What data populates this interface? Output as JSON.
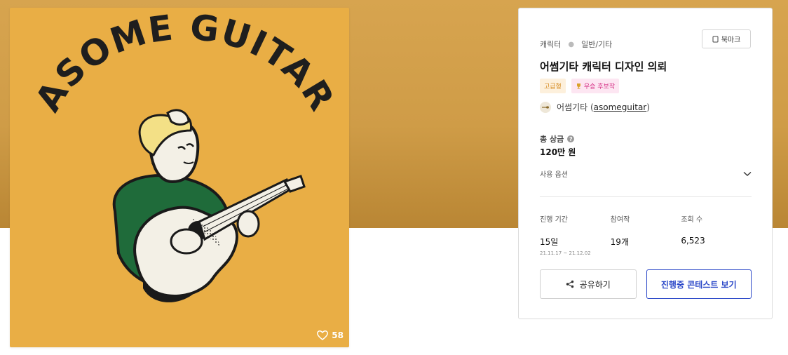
{
  "artwork": {
    "logo_text": "ASOME GUITAR",
    "likes": "58",
    "background_color": "#e9ae45",
    "hero_color": "#d7a44f"
  },
  "card": {
    "category": "캐릭터",
    "subcategory": "일반/기타",
    "bookmark_label": "북마크",
    "title": "어썸기타 캐릭터 디자인 의뢰",
    "badges": [
      {
        "label": "고급형",
        "icon": "none"
      },
      {
        "label": "우승 후보작",
        "icon": "trophy-icon"
      }
    ],
    "owner": {
      "name": "어썸기타",
      "handle": "asomeguitar"
    },
    "prize": {
      "label": "총 상금",
      "value": "120만 원"
    },
    "usage_label": "사용 옵션",
    "stats": [
      {
        "label": "진행 기간",
        "value": "15일",
        "sub": "21.11.17 ~ 21.12.02"
      },
      {
        "label": "참여작",
        "value": "19개"
      },
      {
        "label": "조회 수",
        "value": "6,523"
      }
    ],
    "share_label": "공유하기",
    "view_label": "진행중 콘테스트 보기",
    "accent_color": "#2b48c8"
  }
}
